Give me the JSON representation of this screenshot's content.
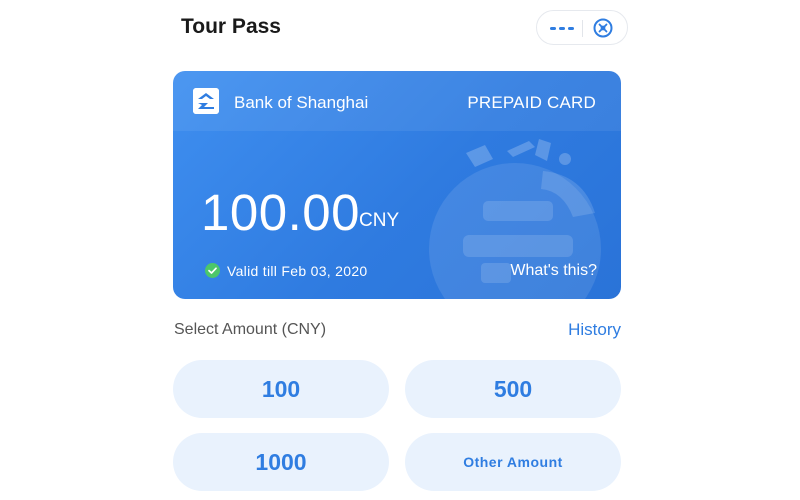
{
  "header": {
    "title": "Tour Pass",
    "more_icon": "more-dots-icon",
    "close_icon": "close-circle-icon"
  },
  "card": {
    "bank_name": "Bank of Shanghai",
    "bank_logo_icon": "bank-logo-icon",
    "card_type": "PREPAID CARD",
    "balance": "100.00",
    "currency": "CNY",
    "validity": "Valid till Feb 03, 2020",
    "validity_icon": "check-circle-icon",
    "help_link": "What's this?"
  },
  "amount_section": {
    "label": "Select Amount (CNY)",
    "history_link": "History",
    "options": [
      {
        "label": "100"
      },
      {
        "label": "500"
      },
      {
        "label": "1000"
      },
      {
        "label": "Other Amount"
      }
    ]
  },
  "colors": {
    "accent": "#2f7de1",
    "card_blue": "#3585e8",
    "button_bg": "#e9f2fd",
    "valid_green": "#4cc76a"
  }
}
